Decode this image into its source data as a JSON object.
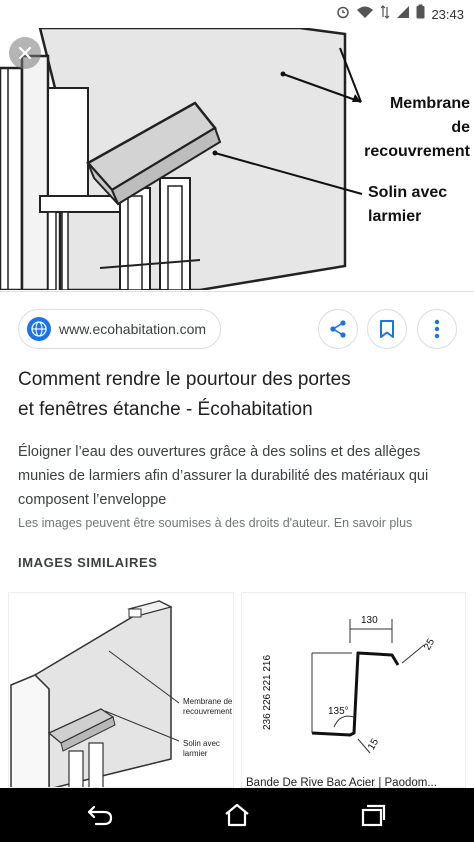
{
  "status_bar": {
    "time": "23:43",
    "icons": [
      "alarm-icon",
      "wifi-icon",
      "data-transfer-icon",
      "signal-icon",
      "battery-icon"
    ]
  },
  "hero": {
    "image_labels": {
      "membrane": [
        "Membrane",
        "de",
        "recouvrement"
      ],
      "solin": [
        "Solin avec",
        "larmier"
      ]
    },
    "close_icon": "close-icon"
  },
  "source": {
    "domain": "www.ecohabitation.com",
    "icon": "globe-icon"
  },
  "actions": {
    "share_icon": "share-icon",
    "bookmark_icon": "bookmark-icon",
    "more_icon": "more-vert-icon"
  },
  "result": {
    "title_line1": "Comment rendre le pourtour des portes",
    "title_line2": "et fenêtres étanche - Écohabitation",
    "description": "Éloigner l’eau des ouvertures grâce à des solins et des allèges munies de larmiers afin d’assurer la durabilité des matériaux qui composent l’enveloppe",
    "copyright": "Les images peuvent être soumises à des droits d'auteur. En savoir plus"
  },
  "similar": {
    "heading": "IMAGES SIMILAIRES",
    "items": [
      {
        "caption": "",
        "labels": [
          "Membrane de",
          "recouvrement",
          "Solin avec",
          "larmier"
        ]
      },
      {
        "caption": "Bande De Rive Bac Acier | Paodom...",
        "labels": [
          "130",
          "25",
          "236 226 221 216",
          "135°",
          "15"
        ]
      }
    ]
  },
  "nav_bar": {
    "icons": [
      "back-icon",
      "home-icon",
      "recents-icon"
    ]
  },
  "colors": {
    "accent": "#1a73e8",
    "border": "#dadce0",
    "text_primary": "#202124",
    "text_secondary": "#3c4043",
    "text_muted": "#70757a"
  }
}
